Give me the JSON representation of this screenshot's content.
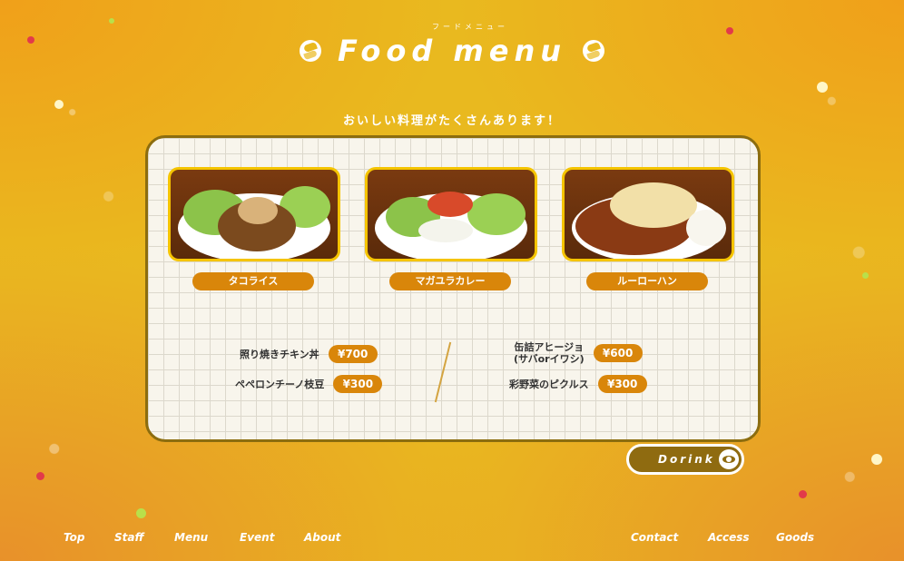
{
  "header": {
    "kana": "フードメニュー",
    "title": "Food menu",
    "subtitle": "おいしい料理がたくさんあります！"
  },
  "dishes": [
    {
      "name": "タコライス"
    },
    {
      "name": "マガユラカレー"
    },
    {
      "name": "ルーローハン"
    }
  ],
  "menu_left": [
    {
      "name": "照り焼きチキン丼",
      "price": "¥700"
    },
    {
      "name": "ペペロンチーノ枝豆",
      "price": "¥300"
    }
  ],
  "menu_right": [
    {
      "name_line1": "缶詰アヒージョ",
      "name_line2": "(サバorイワシ)",
      "price": "¥600"
    },
    {
      "name": "彩野菜のピクルス",
      "price": "¥300"
    }
  ],
  "drink_button": {
    "label": "Dorink"
  },
  "nav": {
    "left": [
      "Top",
      "Staff",
      "Menu",
      "Event",
      "About"
    ],
    "right": [
      "Contact",
      "Access",
      "Goods"
    ]
  },
  "colors": {
    "background": "#e9b91f",
    "accent": "#d9860a",
    "panel": "#f8f5ec",
    "photo_border": "#f5c400"
  }
}
